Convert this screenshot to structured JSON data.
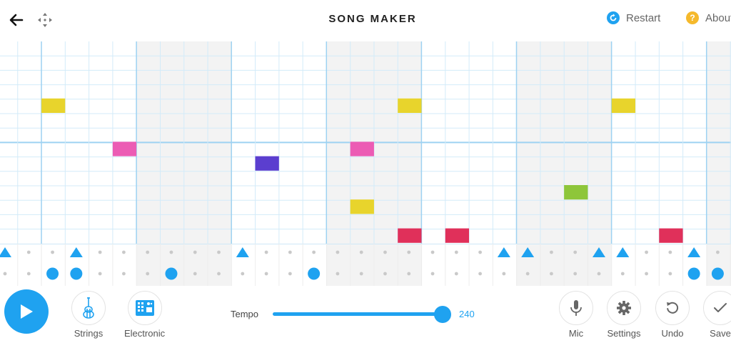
{
  "header": {
    "title": "SONG MAKER",
    "restart_label": "Restart",
    "about_label": "About"
  },
  "melody": {
    "cols": 31,
    "rows": 14,
    "notes": [
      {
        "col": 1,
        "row": 4,
        "color": "#e8d42c"
      },
      {
        "col": 4,
        "row": 7,
        "color": "#ec5cb4"
      },
      {
        "col": 10,
        "row": 8,
        "color": "#5b3ecf"
      },
      {
        "col": 14,
        "row": 7,
        "color": "#ec5cb4"
      },
      {
        "col": 14,
        "row": 11,
        "color": "#e8d42c"
      },
      {
        "col": 16,
        "row": 4,
        "color": "#e8d42c"
      },
      {
        "col": 16,
        "row": 13,
        "color": "#e0305a"
      },
      {
        "col": 18,
        "row": 13,
        "color": "#e0305a"
      },
      {
        "col": 23,
        "row": 10,
        "color": "#8ec63a"
      },
      {
        "col": 25,
        "row": 4,
        "color": "#e8d42c"
      },
      {
        "col": 27,
        "row": 13,
        "color": "#e0305a"
      }
    ]
  },
  "rhythm": {
    "triangles": [
      0,
      3,
      10,
      21,
      22,
      25,
      26,
      29
    ],
    "circles": [
      2,
      3,
      7,
      13,
      29,
      30
    ]
  },
  "footer": {
    "instrument_label": "Strings",
    "percussion_label": "Electronic",
    "tempo_label": "Tempo",
    "tempo_value": "240",
    "tempo_fraction": 1.0,
    "mic_label": "Mic",
    "settings_label": "Settings",
    "undo_label": "Undo",
    "save_label": "Save"
  },
  "colors": {
    "accent": "#1fa2f0",
    "grid_line": "#d3ebf9",
    "bar_line": "#9ed2f2",
    "shaded_bar": "#f3f3f3"
  }
}
